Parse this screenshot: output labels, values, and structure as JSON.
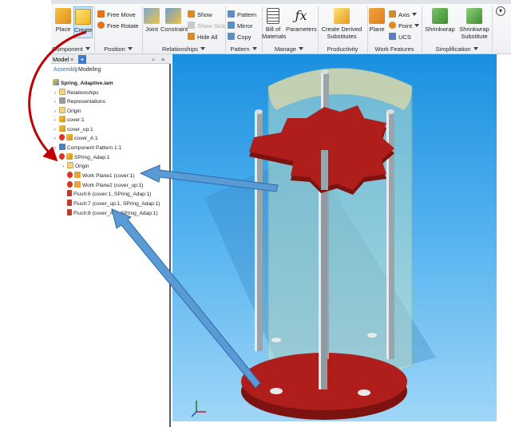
{
  "ribbon": {
    "component_panel": {
      "place_label": "Place",
      "create_label": "Create",
      "panel_label": "Component"
    },
    "position_panel": {
      "free_move": "Free Move",
      "free_rotate": "Free Rotate",
      "panel_label": "Position"
    },
    "relationships_panel": {
      "joint": "Joint",
      "constraint": "Constraint",
      "show": "Show",
      "show_sick": "Show Sick",
      "hide_all": "Hide All",
      "panel_label": "Relationships"
    },
    "pattern_panel": {
      "pattern": "Pattern",
      "mirror": "Mirror",
      "copy": "Copy",
      "panel_label": "Pattern"
    },
    "manage_panel": {
      "bom_line1": "Bill of",
      "bom_line2": "Materials",
      "parameters": "Parameters",
      "panel_label": "Manage"
    },
    "productivity_panel": {
      "create_derived_line1": "Create Derived",
      "create_derived_line2": "Substitutes",
      "panel_label": "Productivity"
    },
    "work_features_panel": {
      "plane": "Plane",
      "axis": "Axis",
      "point": "Point",
      "ucs": "UCS",
      "panel_label": "Work Features"
    },
    "simplification_panel": {
      "shrinkwrap": "Shrinkwrap",
      "shrinkwrap_sub_line1": "Shrinkwrap",
      "shrinkwrap_sub_line2": "Substitute",
      "panel_label": "Simplification"
    }
  },
  "browser": {
    "tab_model": "Model",
    "tab_close": "×",
    "tab_add": "+",
    "subtab_assembly": "Assembly",
    "subtab_separator": "|",
    "subtab_modeling": "Modeling",
    "tree": [
      {
        "label": "Spring_Adaptive.iam",
        "bold": true
      },
      {
        "label": "Relationships"
      },
      {
        "label": "Representations"
      },
      {
        "label": "Origin"
      },
      {
        "label": "cover:1"
      },
      {
        "label": "cover_up:1"
      },
      {
        "label": "cover_A:1"
      },
      {
        "label": "Component Pattern 1:1"
      },
      {
        "label": "SPring_Adap:1"
      },
      {
        "label": "Origin"
      },
      {
        "label": "Work Plane1 (cover:1)"
      },
      {
        "label": "Work Plane2 (cover_up:1)"
      },
      {
        "label": "Flush:6 (cover:1, SPring_Adap:1)"
      },
      {
        "label": "Flush:7 (cover_up:1, SPring_Adap:1)"
      },
      {
        "label": "Flush:8 (cover_A:1, SPring_Adap:1)"
      }
    ]
  },
  "colors": {
    "viewport_top": "#1a8fe0",
    "viewport_bottom": "#9fd6f7",
    "part_red": "#b01e1c",
    "arrow_blue": "#5b9bd5",
    "arrow_red": "#c00000",
    "glass": "#d9ecd0"
  },
  "icons": [
    "place-icon",
    "create-icon",
    "free-move-icon",
    "free-rotate-icon",
    "joint-icon",
    "constraint-icon",
    "show-icon",
    "show-sick-icon",
    "hide-all-icon",
    "pattern-icon",
    "mirror-icon",
    "copy-icon",
    "bom-icon",
    "parameters-fx-icon",
    "create-derived-icon",
    "plane-icon",
    "axis-icon",
    "point-icon",
    "ucs-icon",
    "shrinkwrap-icon",
    "shrinkwrap-substitute-icon",
    "view-cube-axis-icon"
  ]
}
